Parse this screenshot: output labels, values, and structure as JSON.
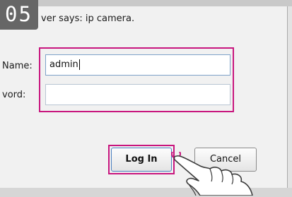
{
  "step": {
    "badge": "05"
  },
  "dialog": {
    "server_text": "ver says: ip camera.",
    "username_label": "Name:",
    "password_label": "vord:",
    "username_value": "admin",
    "password_value": "",
    "login_button": "Log In",
    "cancel_button": "Cancel"
  },
  "colors": {
    "highlight": "#c8167e",
    "badge": "#666666",
    "input_focus_border": "#7ea2c9"
  },
  "icons": {
    "hand_pointer": "tap-hand-icon"
  }
}
